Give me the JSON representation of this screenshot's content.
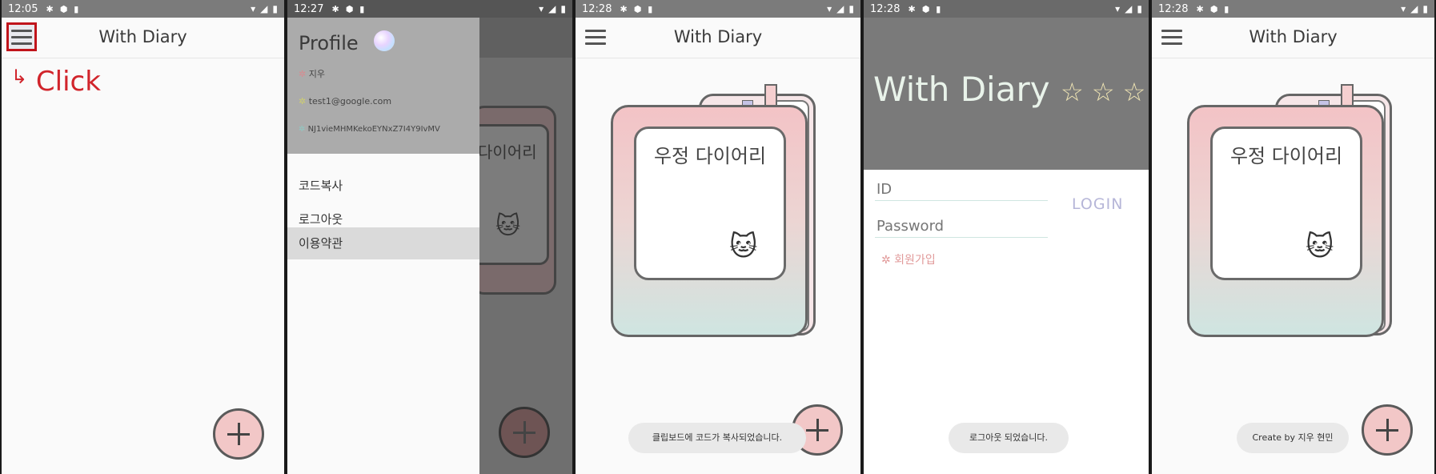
{
  "screens": [
    {
      "status": {
        "time": "12:05"
      },
      "app_title": "With Diary",
      "annotation": {
        "arrow": "↳",
        "text": "Click"
      }
    },
    {
      "status": {
        "time": "12:27"
      },
      "drawer": {
        "profile_title": "Profile",
        "name": "지우",
        "email": "test1@google.com",
        "code": "NJ1vieMHMKekoEYNxZ7I4Y9IvMV",
        "menu": [
          "코드복사",
          "로그아웃",
          "이용약관"
        ]
      },
      "background_cover_text": "다이어리"
    },
    {
      "status": {
        "time": "12:28"
      },
      "app_title": "With Diary",
      "diary_title": "우정 다이어리",
      "toast": "클립보드에 코드가 복사되었습니다."
    },
    {
      "status": {
        "time": "12:28"
      },
      "login": {
        "title": "With Diary",
        "stars": "☆ ☆ ☆",
        "id_placeholder": "ID",
        "password_placeholder": "Password",
        "login_button": "LOGIN",
        "signup_link": "✲ 회원가입"
      },
      "toast": "로그아웃 되었습니다."
    },
    {
      "status": {
        "time": "12:28"
      },
      "app_title": "With Diary",
      "diary_title": "우정 다이어리",
      "toast": "Create by 지우 현민"
    }
  ],
  "colors": {
    "accent_red": "#c0141b",
    "fab_pink": "#f2c7c7",
    "status_gray": "#7b7b7b"
  }
}
